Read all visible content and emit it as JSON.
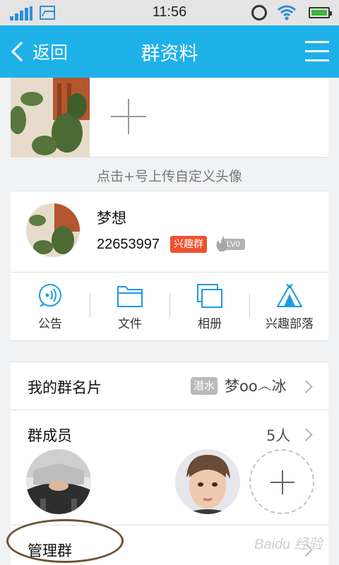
{
  "status_bar": {
    "time": "11:56"
  },
  "nav": {
    "back_label": "返回",
    "title": "群资料"
  },
  "avatar_upload": {
    "hint": "点击+号上传自定义头像"
  },
  "group": {
    "name": "梦想",
    "id": "22653997",
    "tag": "兴趣群",
    "level": "LV0"
  },
  "features": [
    {
      "label": "公告",
      "icon": "announcement-icon"
    },
    {
      "label": "文件",
      "icon": "folder-icon"
    },
    {
      "label": "相册",
      "icon": "album-icon"
    },
    {
      "label": "兴趣部落",
      "icon": "tribe-tent-icon"
    }
  ],
  "my_card": {
    "label": "我的群名片",
    "badge": "潜水",
    "nickname": "梦oo෴冰"
  },
  "members": {
    "label": "群成员",
    "count": "5人"
  },
  "manage": {
    "label": "管理群"
  },
  "watermark": "Baidu 经验",
  "colors": {
    "nav": "#1eb1e8",
    "tag": "#f0502e",
    "icon": "#1e9be0"
  }
}
